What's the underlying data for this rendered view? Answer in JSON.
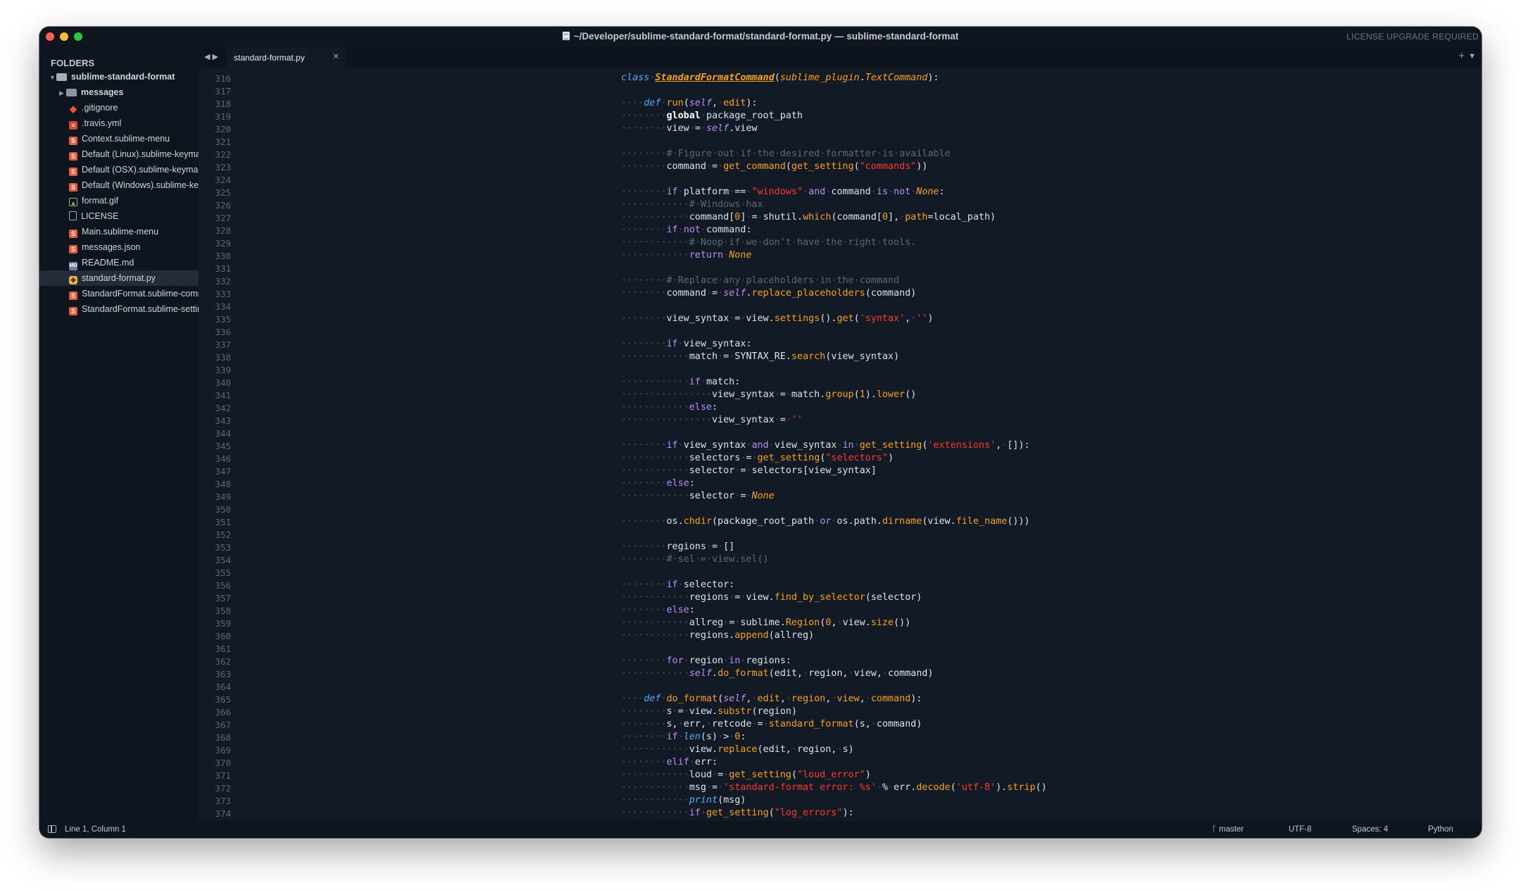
{
  "window": {
    "title": "~/Developer/sublime-standard-format/standard-format.py — sublime-standard-format",
    "license": "LICENSE UPGRADE REQUIRED"
  },
  "sidebar": {
    "header": "FOLDERS",
    "root": "sublime-standard-format",
    "items": [
      {
        "label": "messages",
        "icon": "folder-icon",
        "folder": true
      },
      {
        "label": ".gitignore",
        "icon": "git-icon"
      },
      {
        "label": ".travis.yml",
        "icon": "yml-icon"
      },
      {
        "label": "Context.sublime-menu",
        "icon": "sublime-icon"
      },
      {
        "label": "Default (Linux).sublime-keymap",
        "icon": "sublime-icon"
      },
      {
        "label": "Default (OSX).sublime-keymap",
        "icon": "sublime-icon"
      },
      {
        "label": "Default (Windows).sublime-keymap",
        "icon": "sublime-icon"
      },
      {
        "label": "format.gif",
        "icon": "image-icon"
      },
      {
        "label": "LICENSE",
        "icon": "file-icon"
      },
      {
        "label": "Main.sublime-menu",
        "icon": "sublime-icon"
      },
      {
        "label": "messages.json",
        "icon": "sublime-icon"
      },
      {
        "label": "README.md",
        "icon": "markdown-icon"
      },
      {
        "label": "standard-format.py",
        "icon": "python-icon",
        "selected": true
      },
      {
        "label": "StandardFormat.sublime-commands",
        "icon": "sublime-icon"
      },
      {
        "label": "StandardFormat.sublime-settings",
        "icon": "sublime-icon"
      }
    ]
  },
  "tabs": {
    "active": "standard-format.py"
  },
  "editor": {
    "first_line": 316,
    "lines": [
      "class StandardFormatCommand(sublime_plugin.TextCommand):",
      "",
      "    def run(self, edit):",
      "        global package_root_path",
      "        view = self.view",
      "",
      "        # Figure out if the desired formatter is available",
      "        command = get_command(get_setting(\"commands\"))",
      "",
      "        if platform == \"windows\" and command is not None:",
      "            # Windows hax",
      "            command[0] = shutil.which(command[0], path=local_path)",
      "        if not command:",
      "            # Noop if we don't have the right tools.",
      "            return None",
      "",
      "        # Replace any placeholders in the command",
      "        command = self.replace_placeholders(command)",
      "",
      "        view_syntax = view.settings().get('syntax', '')",
      "",
      "        if view_syntax:",
      "            match = SYNTAX_RE.search(view_syntax)",
      "",
      "            if match:",
      "                view_syntax = match.group(1).lower()",
      "            else:",
      "                view_syntax = ''",
      "",
      "        if view_syntax and view_syntax in get_setting('extensions', []):",
      "            selectors = get_setting(\"selectors\")",
      "            selector = selectors[view_syntax]",
      "        else:",
      "            selector = None",
      "",
      "        os.chdir(package_root_path or os.path.dirname(view.file_name()))",
      "",
      "        regions = []",
      "        # sel = view.sel()",
      "",
      "        if selector:",
      "            regions = view.find_by_selector(selector)",
      "        else:",
      "            allreg = sublime.Region(0, view.size())",
      "            regions.append(allreg)",
      "",
      "        for region in regions:",
      "            self.do_format(edit, region, view, command)",
      "",
      "    def do_format(self, edit, region, view, command):",
      "        s = view.substr(region)",
      "        s, err, retcode = standard_format(s, command)",
      "        if len(s) > 0:",
      "            view.replace(edit, region, s)",
      "        elif err:",
      "            loud = get_setting(\"loud_error\")",
      "            msg = 'standard-format error: %s' % err.decode('utf-8').strip()",
      "            print(msg)",
      "            if get_setting(\"log_errors\"):"
    ]
  },
  "status": {
    "position": "Line 1, Column 1",
    "branch": "master",
    "encoding": "UTF-8",
    "indent": "Spaces: 4",
    "syntax": "Python"
  }
}
